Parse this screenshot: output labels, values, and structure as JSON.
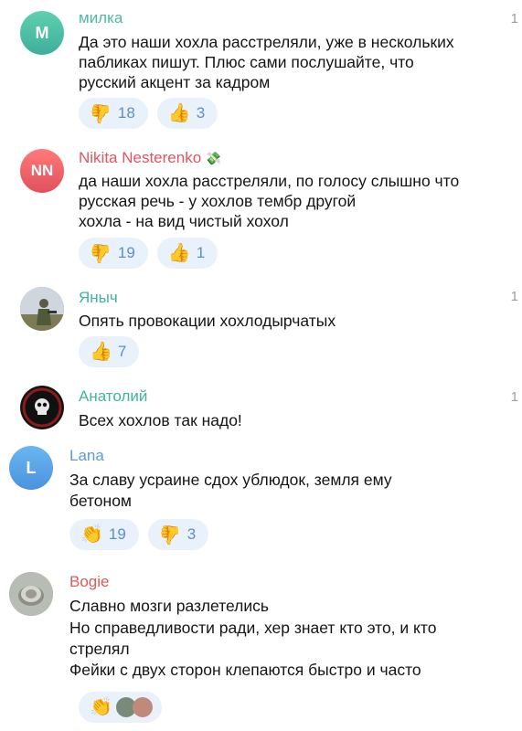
{
  "colors": {
    "reaction_bg": "#e9f1fb",
    "reaction_text": "#5a8fd0",
    "milka": "#4fb8a3",
    "nikita": "#e35461",
    "yanich": "#3fb59a",
    "anatoliy": "#3fb59a",
    "lana": "#5b9bdc",
    "bogie": "#d85c5c"
  },
  "comments": [
    {
      "author": "милка",
      "initials": "M",
      "lines": [
        "Да это наши хохла расстреляли, уже в нескольких",
        "пабликах пишут. Плюс сами послушайте, что",
        "русский акцент за кадром"
      ],
      "side": "1",
      "reactions": [
        {
          "icon": "thumbs-down",
          "count": "18"
        },
        {
          "icon": "thumbs-up",
          "count": "3"
        }
      ]
    },
    {
      "author": "Nikita Nesterenko",
      "author_badge": "💸",
      "initials": "NN",
      "lines": [
        "да наши хохла расстреляли, по голосу слышно что",
        "русская речь - у хохлов тембр другой",
        "хохла - на вид чистый хохол"
      ],
      "reactions": [
        {
          "icon": "thumbs-down",
          "count": "19"
        },
        {
          "icon": "thumbs-up",
          "count": "1"
        }
      ]
    },
    {
      "author": "Яныч",
      "lines": [
        "Опять провокации хохлодырчатых"
      ],
      "side": "1",
      "reactions": [
        {
          "icon": "thumbs-up",
          "count": "7"
        }
      ]
    },
    {
      "author": "Анатолий",
      "lines": [
        "Всех хохлов так надо!"
      ],
      "side": "1"
    },
    {
      "author": "Lana",
      "initials": "L",
      "lines": [
        "За славу усраине сдох ублюдок, земля ему",
        "бетоном"
      ],
      "reactions": [
        {
          "icon": "clapping-hands",
          "count": "19"
        },
        {
          "icon": "thumbs-down",
          "count": "3"
        }
      ]
    },
    {
      "author": "Bogie",
      "lines": [
        "Славно мозги разлетелись",
        "Но справедливости ради, хер знает кто это, и кто",
        "стрелял",
        "Фейки с двух сторон клепаются быстро и часто"
      ],
      "reactions": [
        {
          "icon": "clapping-hands"
        }
      ]
    }
  ],
  "icons": {
    "thumbs-up": "👍",
    "thumbs-down": "👍",
    "clapping-hands": "👏"
  }
}
